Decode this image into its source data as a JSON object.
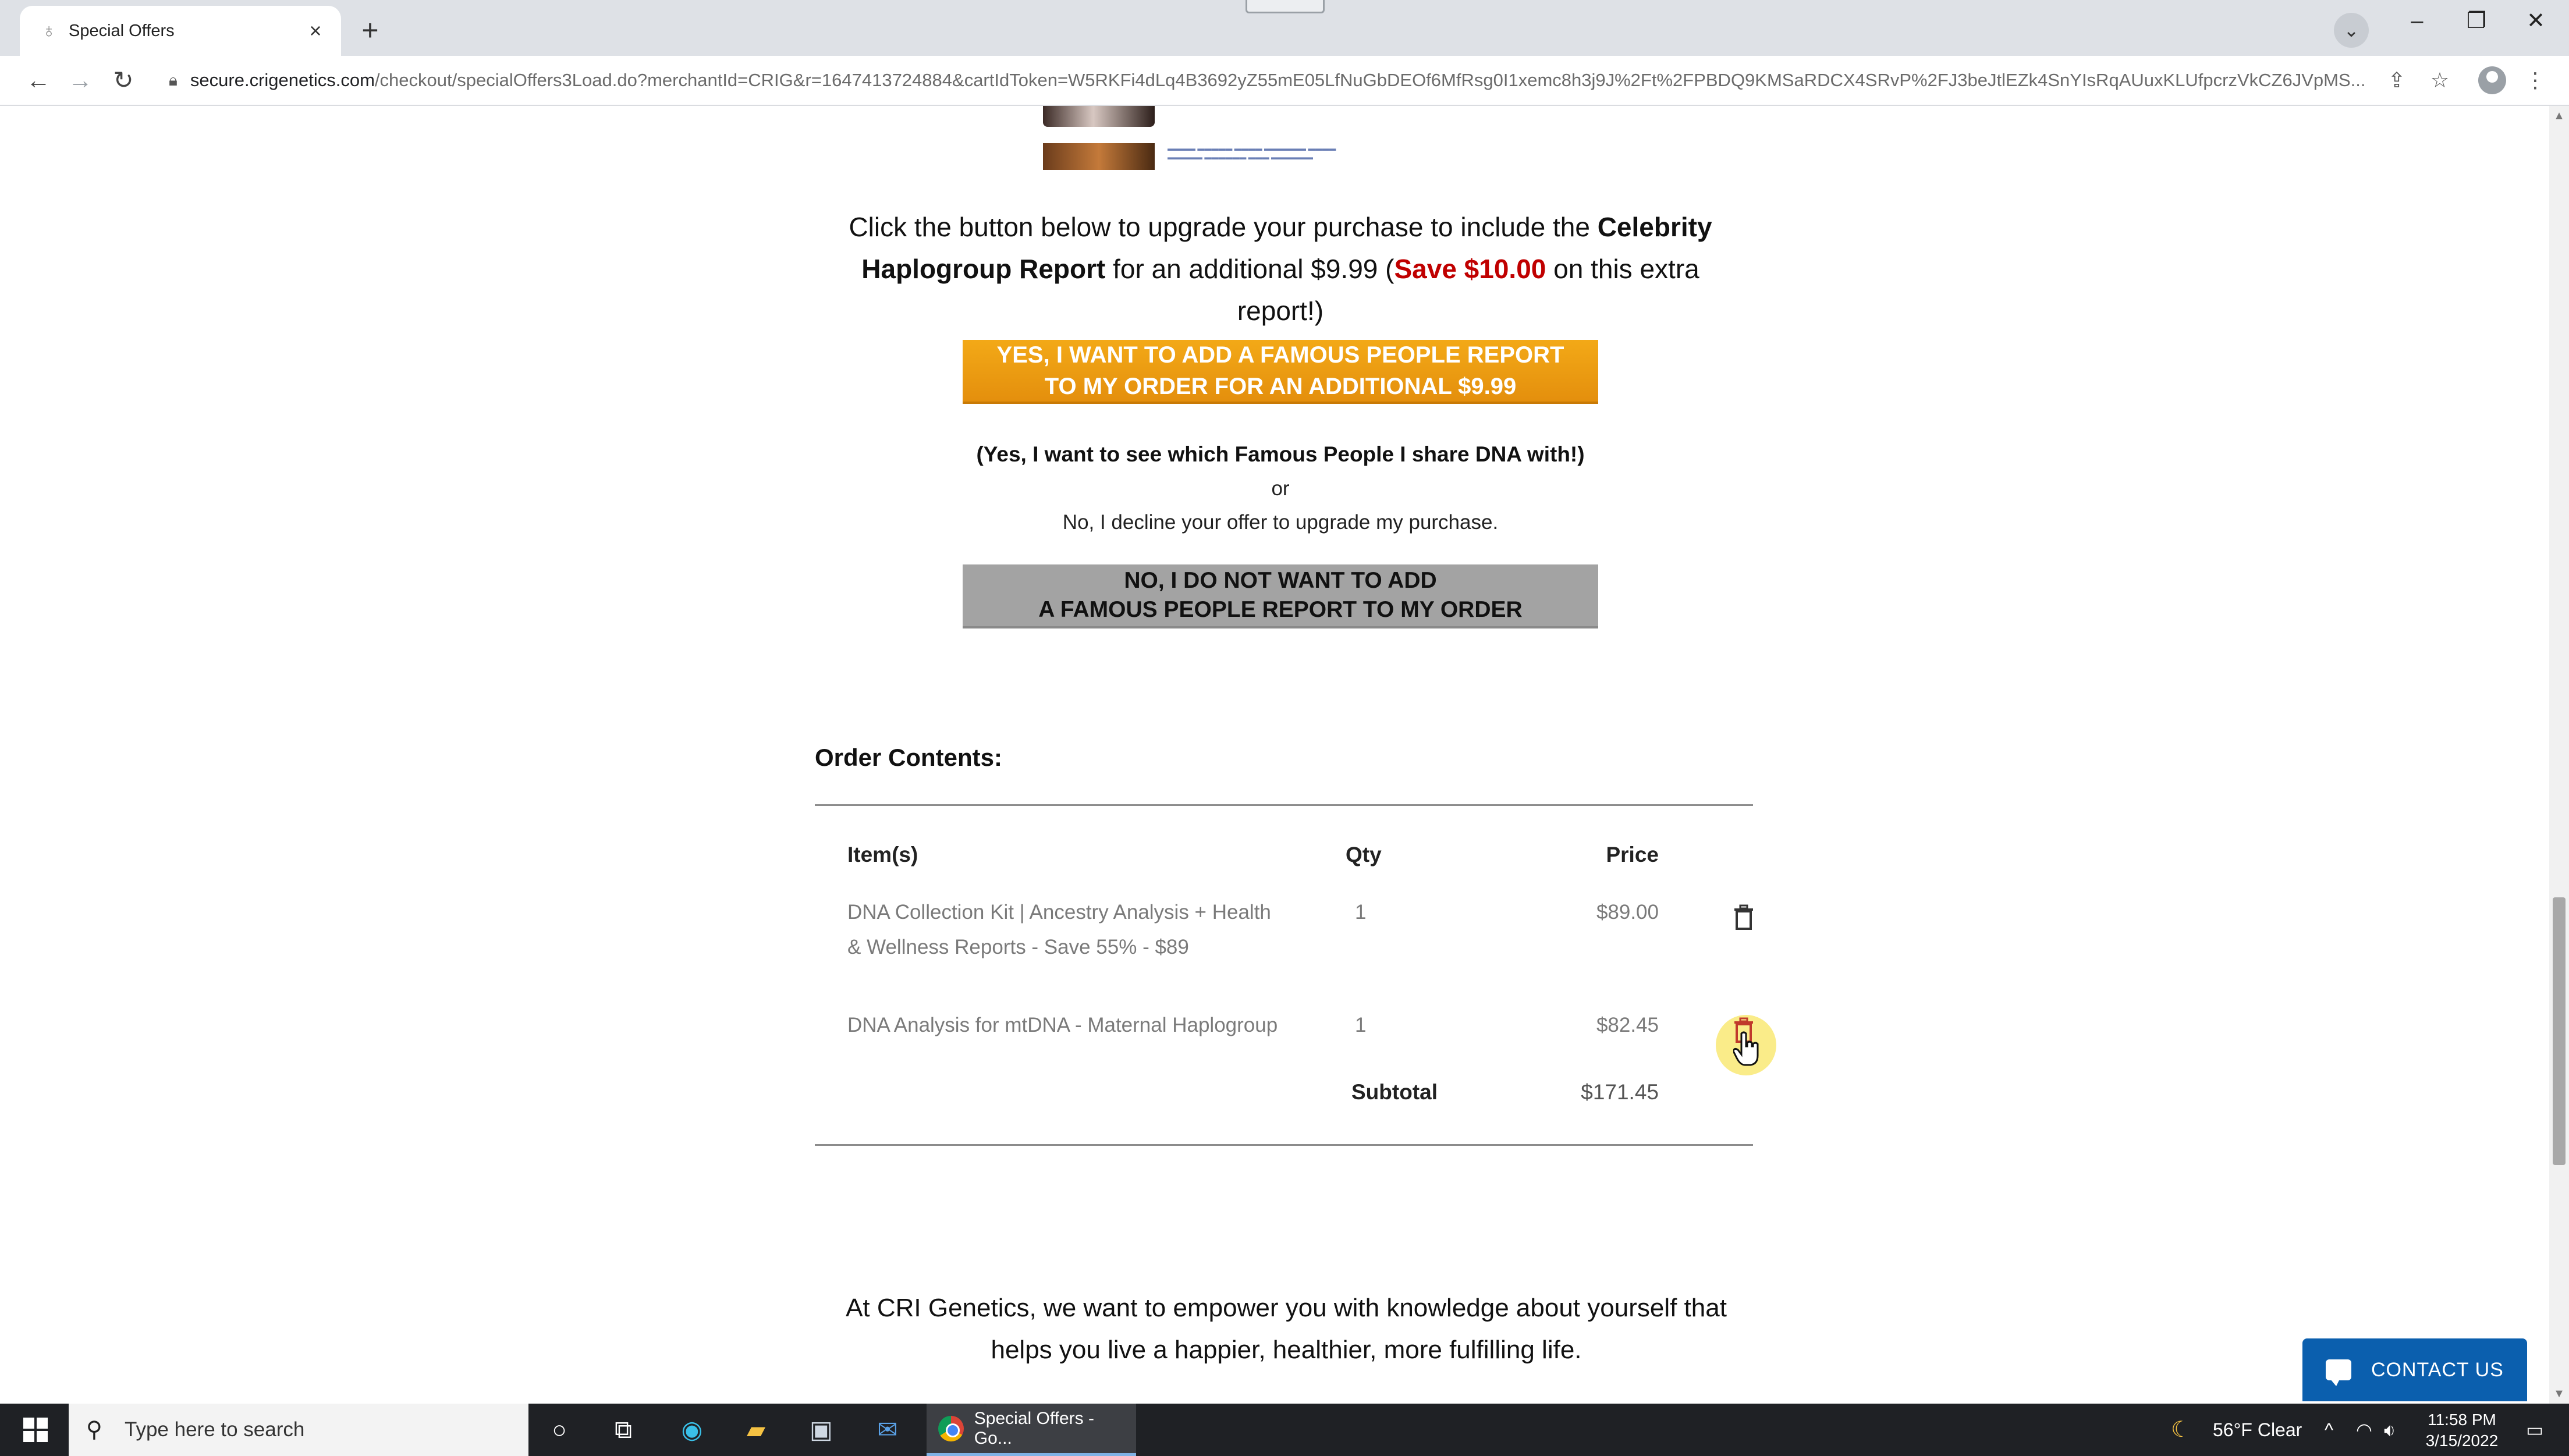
{
  "browser": {
    "tab_title": "Special Offers",
    "tab_close": "×",
    "new_tab": "+",
    "url_host": "secure.crigenetics.com",
    "url_path": "/checkout/specialOffers3Load.do?merchantId=CRIG&r=1647413724884&cartIdToken=W5RKFi4dLq4B3692yZ55mE05LfNuGbDEOf6MfRsg0I1xemc8h3j9J%2Ft%2FPBDQ9KMSaRDCX4SRvP%2FJ3beJtlEZk4SnYIsRqAUuxKLUfpcrzVkCZ6JVpMS..."
  },
  "offer": {
    "line1_pre": "Click the button below to upgrade your purchase to include the ",
    "line1_bold": "Celebrity",
    "line2_bold": "Haplogroup Report",
    "line2_mid": " for an additional $9.99 (",
    "save_text": "Save $10.00",
    "line2_post": " on this extra report!)",
    "yes_button_line1": "YES, I WANT TO ADD A FAMOUS PEOPLE REPORT",
    "yes_button_line2": "TO MY ORDER FOR AN ADDITIONAL $9.99",
    "yes_subtext": "(Yes, I want to see which Famous People I share DNA with!)",
    "or_text": "or",
    "decline_text": "No, I decline your offer to upgrade my purchase.",
    "no_button_line1": "NO, I DO NOT WANT TO ADD",
    "no_button_line2": "A FAMOUS PEOPLE REPORT TO MY ORDER"
  },
  "order": {
    "title": "Order Contents:",
    "headers": {
      "item": "Item(s)",
      "qty": "Qty",
      "price": "Price"
    },
    "rows": [
      {
        "item_line1": "DNA Collection Kit | Ancestry Analysis + Health",
        "item_line2": "& Wellness Reports - Save 55% - $89",
        "qty": "1",
        "price": "$89.00"
      },
      {
        "item_line1": "DNA Analysis for mtDNA - Maternal Haplogroup",
        "item_line2": "",
        "qty": "1",
        "price": "$82.45"
      }
    ],
    "subtotal_label": "Subtotal",
    "subtotal_value": "$171.45"
  },
  "mission": {
    "line1": "At CRI Genetics, we want to empower you with knowledge about yourself that",
    "line2": "helps you live a happier, healthier, more fulfilling life."
  },
  "contact": {
    "label": "CONTACT US"
  },
  "taskbar": {
    "search_placeholder": "Type here to search",
    "chrome_task": "Special Offers - Go...",
    "weather": "56°F  Clear",
    "time": "11:58 PM",
    "date": "3/15/2022"
  },
  "colors": {
    "yes_button": "#e8950f",
    "no_button": "#a3a3a3",
    "save_red": "#c00000",
    "contact_blue": "#0b5fae"
  },
  "icons": [
    "trash-icon",
    "hand-cursor-icon",
    "chat-icon",
    "lock-icon",
    "back-icon",
    "forward-icon",
    "reload-icon",
    "star-icon",
    "share-icon",
    "menu-icon"
  ]
}
